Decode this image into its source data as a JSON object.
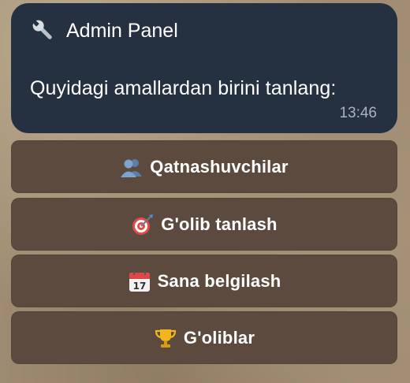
{
  "message": {
    "title": "Admin Panel",
    "title_icon": "wrench-icon",
    "text": "Quyidagi amallardan birini tanlang:",
    "time": "13:46"
  },
  "keyboard": {
    "buttons": [
      {
        "label": "Qatnashuvchilar",
        "icon": "people-icon"
      },
      {
        "label": "G'olib tanlash",
        "icon": "target-dart-icon"
      },
      {
        "label": "Sana belgilash",
        "icon": "calendar-icon"
      },
      {
        "label": "G'oliblar",
        "icon": "trophy-icon"
      }
    ]
  },
  "colors": {
    "bubble": "#253040",
    "button": "#5b4a3d",
    "time_text": "#a9b2bf"
  }
}
